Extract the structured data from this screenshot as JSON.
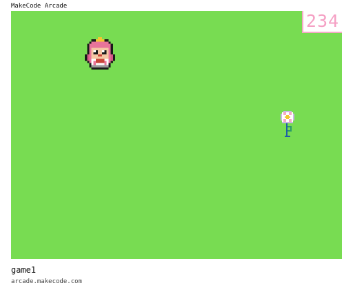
{
  "app": {
    "title": "MakeCode Arcade"
  },
  "game": {
    "name": "game1",
    "url": "arcade.makecode.com",
    "score": "234",
    "colors": {
      "background": "#78dc52",
      "score_text": "#f5a0c4",
      "score_border": "#f5a9c6"
    },
    "sprites": [
      {
        "name": "player-character",
        "icon": "pink-haired-girl-sprite"
      },
      {
        "name": "flower",
        "icon": "white-flower-sprite"
      }
    ]
  }
}
